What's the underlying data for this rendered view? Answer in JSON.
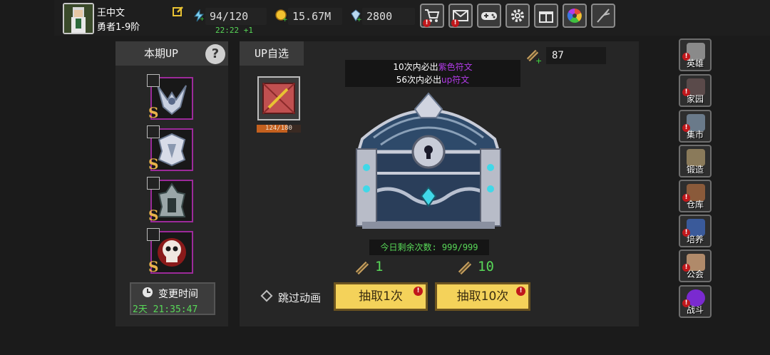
{
  "player": {
    "name": "王中文",
    "rank": "勇者1-9阶"
  },
  "resources": {
    "stamina": "94/120",
    "stamina_timer": "22:22 +1",
    "gold": "15.67M",
    "diamonds": "2800"
  },
  "top_menu": [
    {
      "icon": "shop-cart-icon",
      "has_badge": true
    },
    {
      "icon": "mail-icon",
      "has_badge": true
    },
    {
      "icon": "gamepad-icon",
      "has_badge": false
    },
    {
      "icon": "gear-icon",
      "has_badge": false
    },
    {
      "icon": "gift-icon",
      "has_badge": false
    },
    {
      "icon": "color-wheel-icon",
      "has_badge": false
    },
    {
      "icon": "feather-quill-icon",
      "has_badge": false
    }
  ],
  "left_panel": {
    "title": "本期UP",
    "help_icon": "?",
    "heroes": [
      {
        "grade": "S"
      },
      {
        "grade": "S"
      },
      {
        "grade": "S"
      },
      {
        "grade": "S"
      }
    ],
    "change_time_label": "变更时间",
    "change_time_value": "2天 21:35:47"
  },
  "main_panel": {
    "tab_label": "UP自选",
    "selected_progress": "124/180",
    "selected_progress_fraction": 0.689,
    "scroll_count": "87",
    "info_line1_prefix": "10次内必出",
    "info_line1_highlight": "紫色符文",
    "info_line2_prefix": "56次内必出",
    "info_line2_highlight": "up符文",
    "remaining_label": "今日剩余次数: 999/999",
    "cost_single": "1",
    "cost_ten": "10",
    "skip_label": "跳过动画",
    "draw_one": "抽取1次",
    "draw_ten": "抽取10次",
    "badge_mark": "!"
  },
  "side_menu": [
    {
      "label": "英雄",
      "icon": "helmet-icon",
      "color": "#8a8a8a"
    },
    {
      "label": "家园",
      "icon": "castle-icon",
      "color": "#5a4a4a"
    },
    {
      "label": "集市",
      "icon": "market-icon",
      "color": "#6a7a8a"
    },
    {
      "label": "锻造",
      "icon": "hammer-icon",
      "color": "#8a7a5a"
    },
    {
      "label": "仓库",
      "icon": "chest-icon",
      "color": "#8a5a3a"
    },
    {
      "label": "培养",
      "icon": "goblet-icon",
      "color": "#3a5a9a"
    },
    {
      "label": "公会",
      "icon": "guild-icon",
      "color": "#b08a6a"
    },
    {
      "label": "战斗",
      "icon": "portal-icon",
      "color": "#7a2ad0"
    }
  ],
  "colors": {
    "accent_purple": "#b23be8",
    "green_text": "#58d858",
    "badge_red": "#c0171b",
    "button_yellow": "#f4d25a"
  }
}
